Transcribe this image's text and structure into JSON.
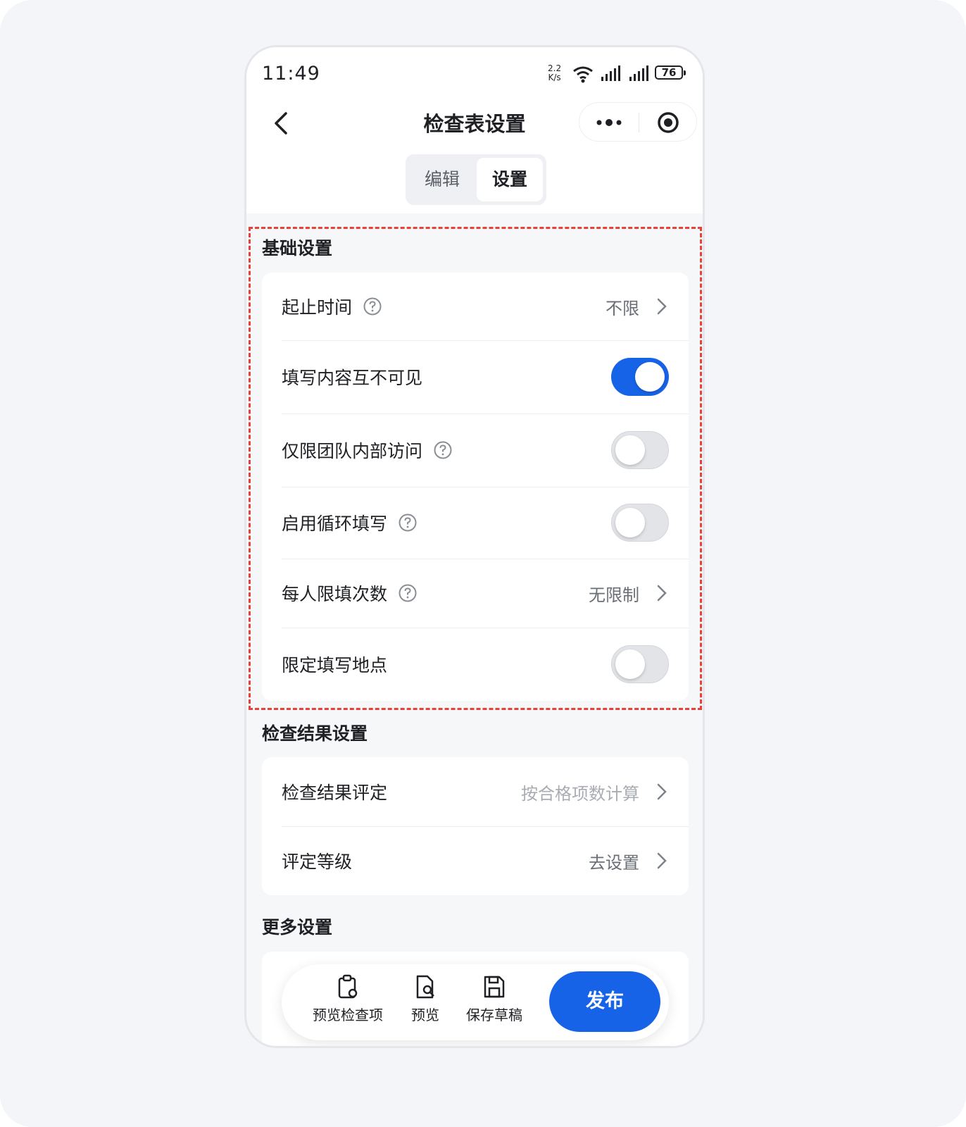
{
  "status_bar": {
    "time": "11:49",
    "net_speed_value": "2.2",
    "net_speed_unit": "K/s",
    "battery": "76"
  },
  "nav": {
    "title": "检查表设置"
  },
  "tabs": [
    {
      "label": "编辑"
    },
    {
      "label": "设置",
      "active": true
    }
  ],
  "sections": {
    "basic": {
      "title": "基础设置",
      "rows": [
        {
          "label": "起止时间",
          "has_help": true,
          "value": "不限",
          "control": "chevron"
        },
        {
          "label": "填写内容互不可见",
          "has_help": false,
          "control": "toggle",
          "checked": true
        },
        {
          "label": "仅限团队内部访问",
          "has_help": true,
          "control": "toggle",
          "checked": false
        },
        {
          "label": "启用循环填写",
          "has_help": true,
          "control": "toggle",
          "checked": false
        },
        {
          "label": "每人限填次数",
          "has_help": true,
          "value": "无限制",
          "control": "chevron"
        },
        {
          "label": "限定填写地点",
          "has_help": false,
          "control": "toggle",
          "checked": false
        }
      ]
    },
    "result": {
      "title": "检查结果设置",
      "rows": [
        {
          "label": "检查结果评定",
          "value": "按合格项数计算",
          "control": "chevron",
          "value_muted": true
        },
        {
          "label": "评定等级",
          "value": "去设置",
          "control": "chevron"
        }
      ]
    },
    "more": {
      "title": "更多设置"
    }
  },
  "bottom_bar": {
    "actions": [
      {
        "label": "预览检查项",
        "icon": "clipboard-preview-icon"
      },
      {
        "label": "预览",
        "icon": "document-search-icon"
      },
      {
        "label": "保存草稿",
        "icon": "floppy-disk-icon"
      }
    ],
    "publish_label": "发布"
  },
  "colors": {
    "accent": "#1763e8",
    "highlight_border": "#e8413a"
  }
}
